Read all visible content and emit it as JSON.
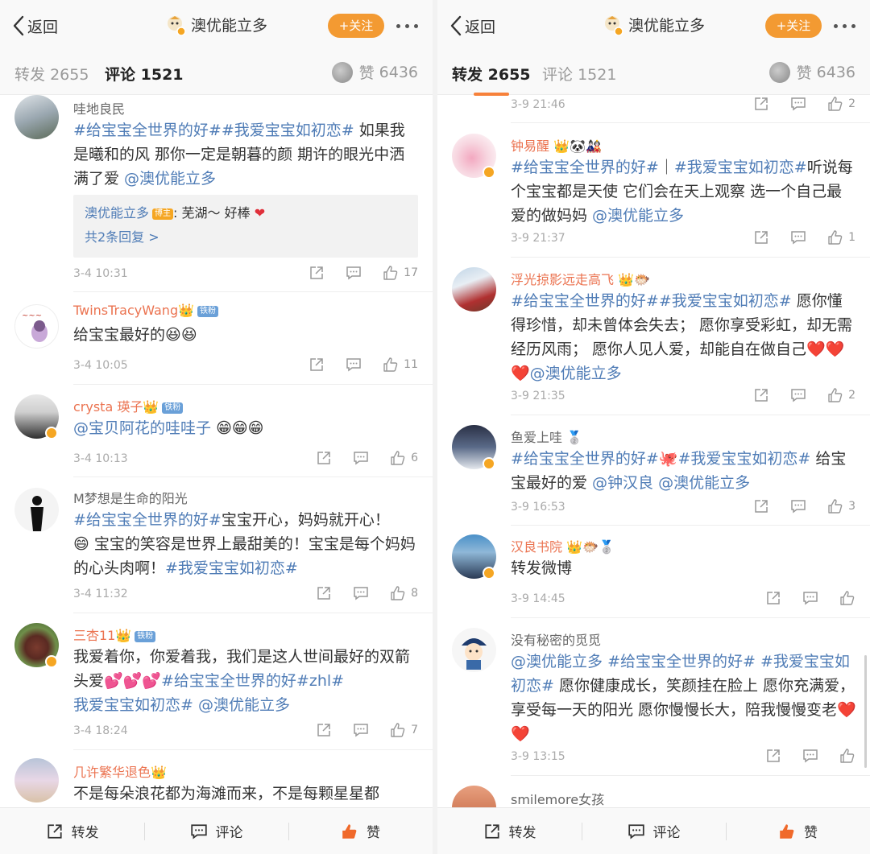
{
  "colors": {
    "accent": "#f39a32",
    "link": "#4f7cb6",
    "vip_name": "#eb7350",
    "like_active": "#f0692a"
  },
  "nav": {
    "back_label": "返回",
    "account_name": "澳优能立多",
    "follow_label": "+关注"
  },
  "tabs": {
    "repost_label": "转发",
    "repost_count": "2655",
    "comment_label": "评论",
    "comment_count": "1521",
    "like_label": "赞",
    "like_count": "6436"
  },
  "bottom_bar": {
    "repost": "转发",
    "comment": "评论",
    "like": "赞"
  },
  "left": {
    "comments": [
      {
        "name": "哇地良民",
        "text": [
          "#给宝宝全世界的好##我爱宝宝如初恋#",
          " 如果我是曦和的风 那你一定是朝暮的颜 期许的眼光中洒满了爱 ",
          "@澳优能立多"
        ],
        "reply_author": "澳优能立多",
        "reply_tag": "博主",
        "reply_text": ": 芜湖～ 好棒",
        "reply_more": "共2条回复 >",
        "time": "3-4 10:31",
        "likes": "17"
      },
      {
        "name": "TwinsTracyWang",
        "badge": "铁粉",
        "text": "给宝宝最好的",
        "time": "3-4 10:05",
        "likes": "11"
      },
      {
        "name": "crysta 瑛子",
        "badge": "铁粉",
        "text": "@宝贝阿花的哇哇子",
        "time": "3-4 10:13",
        "likes": "6"
      },
      {
        "name": "M梦想是生命的阳光",
        "text": [
          "#给宝宝全世界的好#",
          "宝宝开心，妈妈就开心！",
          " 宝宝的笑容是世界上最甜美的！宝宝是每个妈妈的心头肉啊！",
          "#我爱宝宝如初恋#"
        ],
        "time": "3-4 11:32",
        "likes": "8"
      },
      {
        "name": "三杏11",
        "badge": "铁粉",
        "text": [
          "我爱着你，你爱着我，我们是这人世间最好的双箭头爱",
          "#给宝宝全世界的好#zhl#",
          "我爱宝宝如初恋#",
          " @澳优能立多"
        ],
        "time": "3-4 18:24",
        "likes": "7"
      },
      {
        "name": "几许繁华退色",
        "text": "不是每朵浪花都为海滩而来，不是每颗星星都"
      }
    ]
  },
  "right": {
    "top_partial": {
      "time": "3-9 21:46",
      "likes": "2"
    },
    "comments": [
      {
        "name": "钟易醒",
        "text": [
          "#给宝宝全世界的好#",
          "｜",
          "#我爱宝宝如初恋#",
          "听说每个宝宝都是天使 它们会在天上观察 选一个自己最爱的做妈妈 ",
          "@澳优能立多"
        ],
        "time": "3-9 21:37",
        "likes": "1"
      },
      {
        "name": "浮光掠影远走高飞",
        "text": [
          "#给宝宝全世界的好##我爱宝宝如初恋#",
          " 愿你懂得珍惜，却未曾体会失去； 愿你享受彩虹，却无需经历风雨； 愿你人见人爱，却能自在做自己",
          "@澳优能立多"
        ],
        "time": "3-9 21:35",
        "likes": "2"
      },
      {
        "name": "鱼爱上哇",
        "text": [
          "#给宝宝全世界的好#",
          "#我爱宝宝如初恋#",
          " 给宝宝最好的爱 ",
          "@钟汉良",
          " ",
          "@澳优能立多"
        ],
        "time": "3-9 16:53",
        "likes": "3"
      },
      {
        "name": "汉良书院",
        "text": "转发微博",
        "time": "3-9 14:45"
      },
      {
        "name": "没有秘密的觅觅",
        "text": [
          "@澳优能立多",
          " ",
          "#给宝宝全世界的好#",
          " ",
          "#我爱宝宝如初恋#",
          " 愿你健康成长，笑颜挂在脸上 愿你充满爱，享受每一天的阳光 愿你慢慢长大，陪我慢慢变老"
        ],
        "time": "3-9 13:15"
      },
      {
        "name": "smilemore女孩"
      }
    ]
  }
}
